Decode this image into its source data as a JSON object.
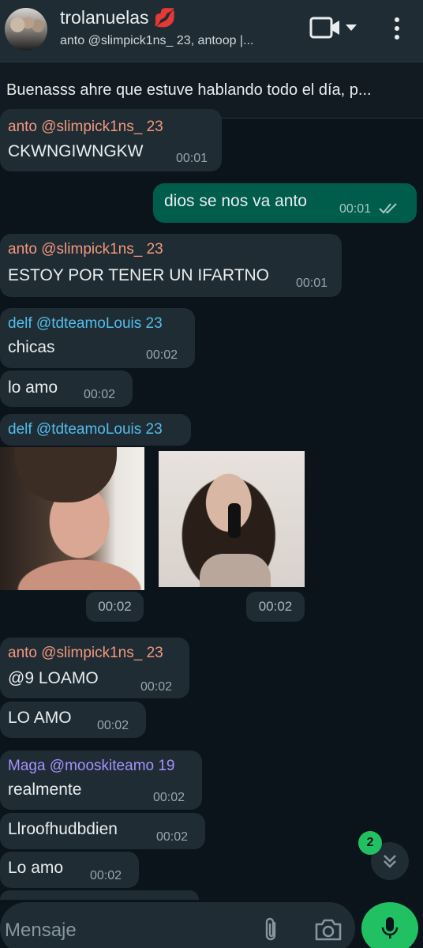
{
  "header": {
    "title": "trolanuelas 💋",
    "subtitle": "anto @slimpick1ns_ 23, antoop |..."
  },
  "pinned": {
    "text": "Buenasss ahre que estuve hablando todo el día, p..."
  },
  "messages": [
    {
      "sender": "anto @slimpick1ns_ 23",
      "text": "CKWNGIWNGKW",
      "time": "00:01"
    },
    {
      "text": "dios se nos va anto",
      "time": "00:01",
      "outgoing": true
    },
    {
      "sender": "anto @slimpick1ns_ 23",
      "text": "ESTOY POR TENER UN IFARTNO",
      "time": "00:01"
    },
    {
      "sender": "delf @tdteamoLouis 23",
      "text": "chicas",
      "time": "00:02"
    },
    {
      "text": "lo amo",
      "time": "00:02"
    },
    {
      "sender": "delf @tdteamoLouis 23",
      "photos": [
        {
          "time": "00:02"
        },
        {
          "time": "00:02"
        }
      ]
    },
    {
      "sender": "anto @slimpick1ns_ 23",
      "text": "@9 LOAMO",
      "time": "00:02"
    },
    {
      "text": "LO AMO",
      "time": "00:02"
    },
    {
      "sender": "Maga @mooskiteamo 19",
      "text": "realmente",
      "time": "00:02"
    },
    {
      "text": "Llroofhudbdien",
      "time": "00:02"
    },
    {
      "text": "Lo amo",
      "time": "00:02"
    }
  ],
  "colors": {
    "anto": "#f5987e",
    "delf": "#53bdeb",
    "maga": "#a791ff",
    "accent": "#21c063"
  },
  "scroll": {
    "unread_count": "2"
  },
  "input": {
    "placeholder": "Mensaje"
  },
  "icons": [
    "video-call-icon",
    "chevron-down-icon",
    "more-vert-icon",
    "attach-icon",
    "camera-icon",
    "mic-icon",
    "double-chevron-down-icon",
    "double-check-icon"
  ]
}
